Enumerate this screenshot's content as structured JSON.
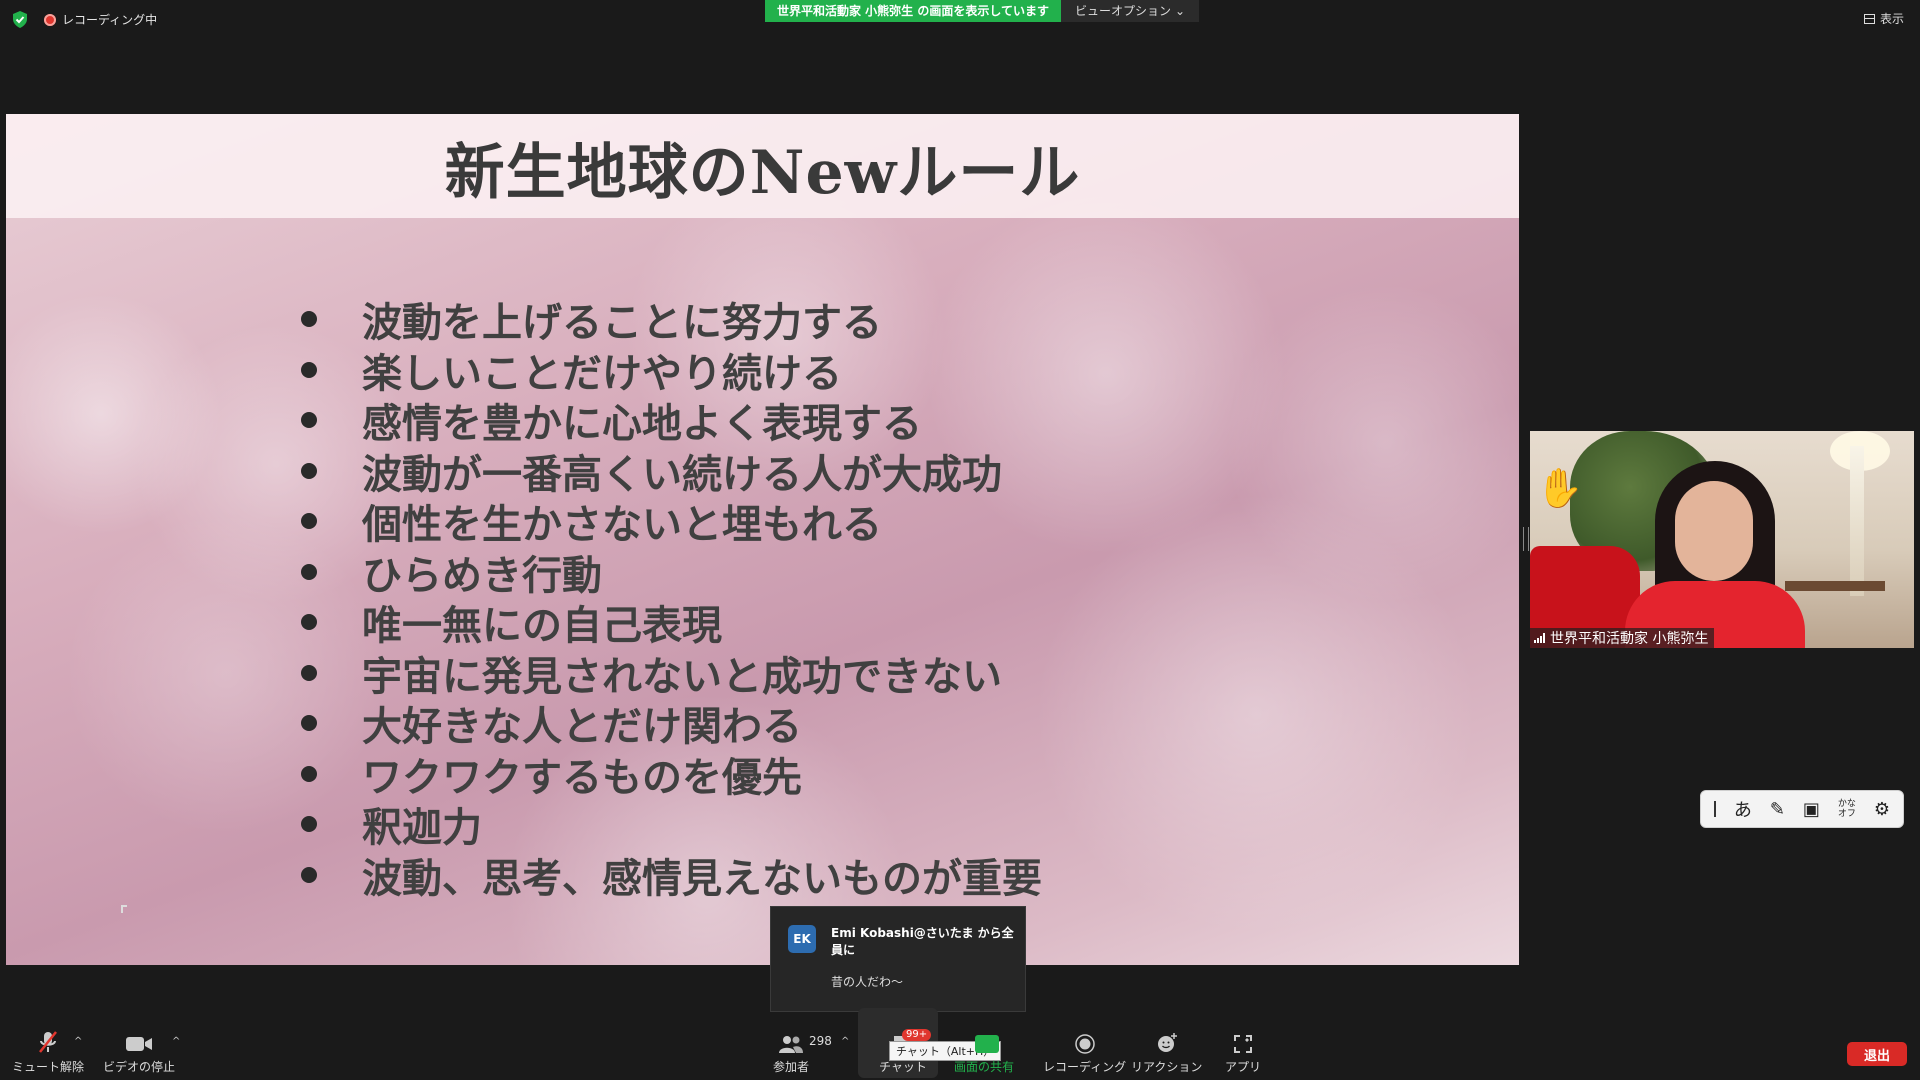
{
  "topbar": {
    "recording": "レコーディング中",
    "share_banner": "世界平和活動家 小熊弥生 の画面を表示しています",
    "view_options": "ビューオプション",
    "display": "表示"
  },
  "slide": {
    "title": "新生地球のNewルール",
    "items": [
      "波動を上げることに努力する",
      "楽しいことだけやり続ける",
      "感情を豊かに心地よく表現する",
      "波動が一番高くい続ける人が大成功",
      "個性を生かさないと埋もれる",
      "ひらめき行動",
      "唯一無にの自己表現",
      "宇宙に発見されないと成功できない",
      "大好きな人とだけ関わる",
      "ワクワクするものを優先",
      "釈迦力",
      "波動、思考、感情見えないものが重要"
    ]
  },
  "video": {
    "participant_name": "世界平和活動家 小熊弥生",
    "raise_hand": "✋"
  },
  "ime": {
    "hiragana": "あ",
    "kana_off_top": "かな",
    "kana_off_bottom": "オフ"
  },
  "chat_popup": {
    "avatar": "EK",
    "sender": "Emi Kobashi@さいたま から全員に",
    "message": "昔の人だわ〜"
  },
  "toolbar": {
    "mute": "ミュート解除",
    "video": "ビデオの停止",
    "participants": "参加者",
    "participant_count": "298",
    "chat": "チャット",
    "chat_badge": "99+",
    "chat_tooltip": "チャット（Alt+H）",
    "share": "画面の共有",
    "record": "レコーディング",
    "reactions": "リアクション",
    "apps": "アプリ",
    "leave": "退出"
  },
  "colors": {
    "share_green": "#22b14c",
    "leave_red": "#d92a26",
    "recording_red": "#e0362e"
  }
}
